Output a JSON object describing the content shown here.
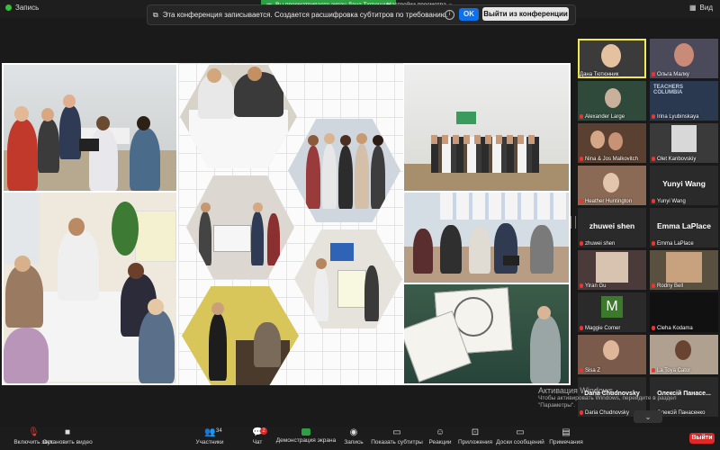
{
  "top": {
    "recording_label": "Запись",
    "view_label": "Вид",
    "share_banner": "Вы просматриваете экран Дана Тютюнник",
    "view_settings": "Настройки просмотра"
  },
  "recording_notice": {
    "message": "Эта конференция записывается. Создается расшифровка субтитров по требованию.",
    "ok_label": "OK",
    "leave_label": "Выйти из конференции"
  },
  "participants": [
    {
      "name": "Дана Тютюнник",
      "active": true
    },
    {
      "name": "Ольга Малку",
      "active": false
    },
    {
      "name": "Alexander Large",
      "active": false
    },
    {
      "name": "Irina Lyubinskaya",
      "active": false
    },
    {
      "name": "Nina & Jos Malkovitch",
      "active": false
    },
    {
      "name": "Olet Kanbovskiy",
      "active": false
    },
    {
      "name": "Heather Huntington",
      "active": false
    },
    {
      "name": "Yunyi Wang",
      "big": "Yunyi Wang",
      "active": false
    },
    {
      "name": "zhuwei shen",
      "big": "zhuwei shen",
      "active": false
    },
    {
      "name": "Emma LaPlace",
      "big": "Emma LaPlace",
      "active": false
    },
    {
      "name": "Yiran Gu",
      "active": false
    },
    {
      "name": "Rodny Bell",
      "active": false
    },
    {
      "name": "Maggie Comer",
      "letter": "M",
      "active": false
    },
    {
      "name": "Cleha Kodama",
      "active": false
    },
    {
      "name": "Sisa Z",
      "active": false
    },
    {
      "name": "La Toya Cator",
      "active": false
    },
    {
      "name": "Daria Chudnovsky",
      "big": "Daria Chudnovsky",
      "active": false
    },
    {
      "name": "Олексій Панасенко",
      "big": "Олексій Панасе...",
      "active": false
    }
  ],
  "activation": {
    "title": "Активация Windows",
    "line1": "Чтобы активировать Windows, перейдите в раздел",
    "line2": "\"Параметры\"."
  },
  "toolbar": {
    "mute": "Включить звук",
    "video": "Остановить видео",
    "participants": "Участники",
    "participants_count": "34",
    "chat": "Чат",
    "chat_badge": "2",
    "share": "Демонстрация экрана",
    "record": "Запись",
    "captions": "Показать субтитры",
    "reactions": "Реакции",
    "apps": "Приложения",
    "whiteboards": "Доски сообщений",
    "notes": "Примечания",
    "leave": "Выйти"
  },
  "colors": {
    "share_green": "#2ea043",
    "ok_blue": "#0e71eb",
    "leave_red": "#e02828",
    "active_yellow": "#f2e94e"
  }
}
